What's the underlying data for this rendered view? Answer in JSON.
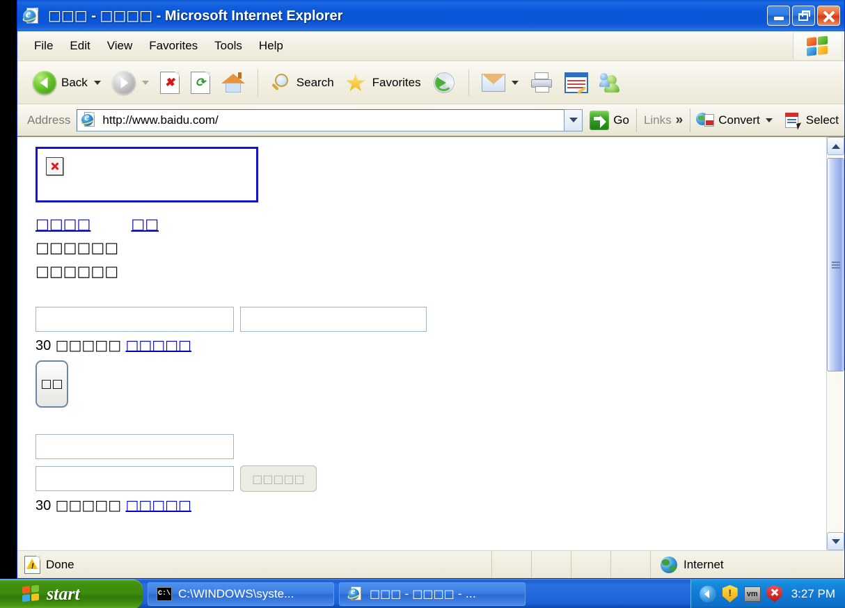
{
  "window": {
    "title": "□□□ - □□□□ - Microsoft Internet Explorer",
    "title_tofu_1": "□□□",
    "title_sep1": " - ",
    "title_tofu_2": "□□□□",
    "title_sep2": " - ",
    "title_app": "Microsoft Internet Explorer",
    "minimize_label": "Minimize",
    "maximize_label": "Restore",
    "close_label": "Close"
  },
  "menu": {
    "items": [
      {
        "label": "File"
      },
      {
        "label": "Edit"
      },
      {
        "label": "View"
      },
      {
        "label": "Favorites"
      },
      {
        "label": "Tools"
      },
      {
        "label": "Help"
      }
    ],
    "logo_icon": "windows-flag-icon"
  },
  "toolbar": {
    "back_label": "Back",
    "back_icon": "back-arrow-icon",
    "forward_icon": "forward-arrow-icon",
    "stop_icon": "stop-icon",
    "stop_glyph": "✖",
    "refresh_icon": "refresh-icon",
    "refresh_glyph": "⟳",
    "home_icon": "home-icon",
    "search_label": "Search",
    "search_icon": "magnifier-icon",
    "favorites_label": "Favorites",
    "favorites_icon": "star-icon",
    "media_icon": "media-icon",
    "mail_icon": "mail-icon",
    "print_icon": "printer-icon",
    "edit_icon": "edit-page-icon",
    "messenger_icon": "messenger-icon"
  },
  "address": {
    "label": "Address",
    "icon": "ie-page-icon",
    "url": "http://www.baidu.com/",
    "dropdown_icon": "chevron-down-icon",
    "go_label": "Go",
    "go_icon": "go-arrow-icon",
    "links_label": "Links",
    "links_more_icon": "double-chevron-icon",
    "links_more_glyph": "»",
    "convert_label": "Convert",
    "convert_icon": "pdf-convert-icon",
    "convert_dropdown_icon": "caret-down-icon",
    "select_label": "Select",
    "select_icon": "pdf-select-icon"
  },
  "page": {
    "logo_box": {
      "alt_icon": "broken-image-icon"
    },
    "nav_links": [
      {
        "text": "□□□□"
      },
      {
        "text": "□□"
      }
    ],
    "text_lines": [
      {
        "text": "□□□□□□"
      },
      {
        "text": "□□□□□□"
      }
    ],
    "form_a": {
      "input_1_value": "",
      "input_2_value": "",
      "note_number": "30",
      "note_text": "□□□□□",
      "note_link": "□□□□□",
      "submit_label": "□□"
    },
    "form_b": {
      "input_1_value": "",
      "input_2_value": "",
      "button_label": "□□□□□",
      "note_number": "30",
      "note_text": "□□□□□",
      "note_link": "□□□□□"
    }
  },
  "scrollbar": {
    "up_icon": "scroll-up-icon",
    "down_icon": "scroll-down-icon",
    "thumb_label": "scroll-thumb"
  },
  "statusbar": {
    "icon": "warning-page-icon",
    "text": "Done",
    "zone_icon": "globe-icon",
    "zone_text": "Internet"
  },
  "taskbar": {
    "start_label": "start",
    "start_icon": "windows-flag-icon",
    "tasks": [
      {
        "icon": "command-prompt-icon",
        "icon_glyph": "C:\\",
        "label": "C:\\WINDOWS\\syste..."
      },
      {
        "icon": "ie-icon",
        "label": "□□□ - □□□□ - ..."
      }
    ],
    "tray": {
      "expand_icon": "tray-expand-icon",
      "security_icon": "yellow-shield-warning-icon",
      "vm_icon": "vmware-tools-icon",
      "vm_label": "vm",
      "antivirus_icon": "red-shield-alert-icon",
      "clock": "3:27 PM"
    }
  },
  "colors": {
    "titlebar_blue": "#0b55d7",
    "link_blue": "#0000cc",
    "logo_border": "#1414cc",
    "taskbar_blue": "#1e62d8",
    "start_green": "#3d8c0d",
    "chrome_beige": "#ece9d8"
  }
}
